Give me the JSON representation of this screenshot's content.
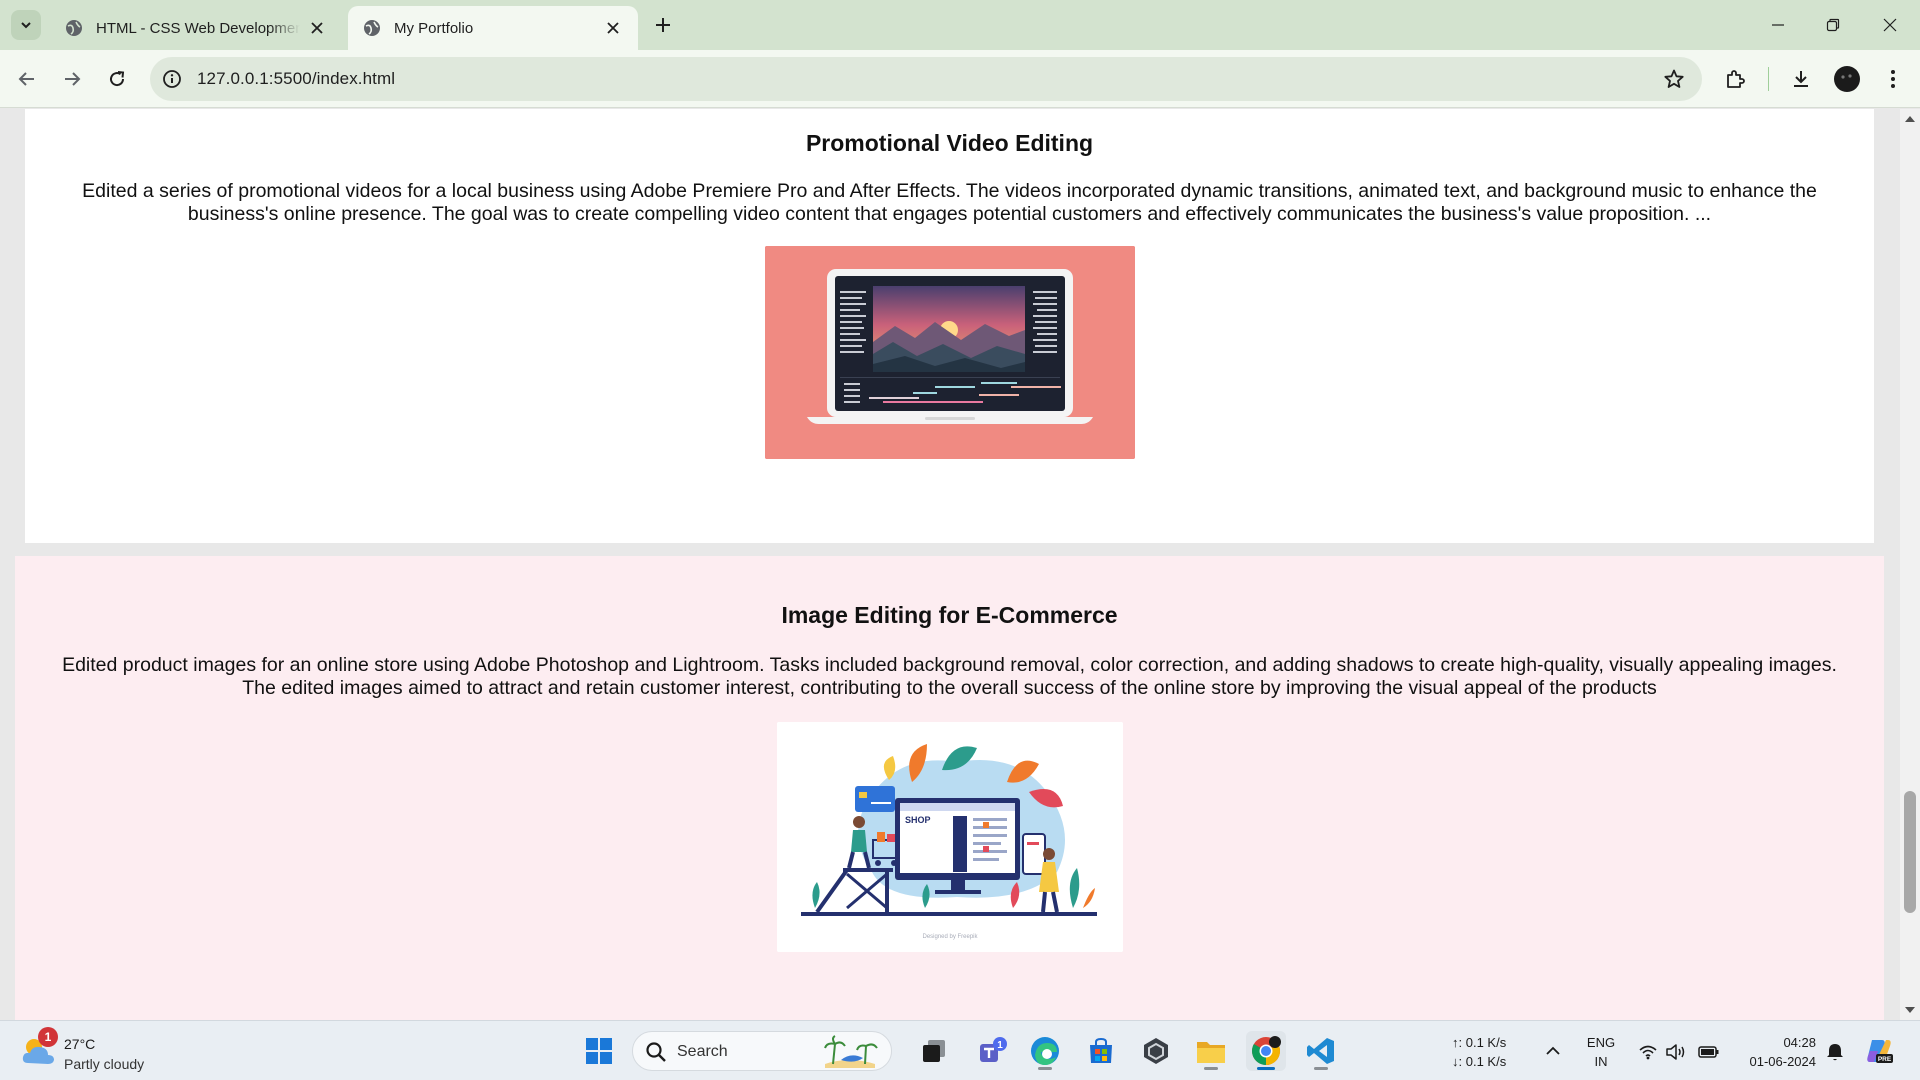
{
  "browser": {
    "tabs": [
      {
        "title": "HTML - CSS Web Development",
        "active": false
      },
      {
        "title": "My Portfolio",
        "active": true
      }
    ],
    "url": "127.0.0.1:5500/index.html"
  },
  "page": {
    "projects": [
      {
        "title": "Promotional Video Editing",
        "description": "Edited a series of promotional videos for a local business using Adobe Premiere Pro and After Effects. The videos incorporated dynamic transitions, animated text, and background music to enhance the business's online presence. The goal was to create compelling video content that engages potential customers and effectively communicates the business's value proposition. ...",
        "image_subject": "laptop-video-editor-illustration"
      },
      {
        "title": "Image Editing for E-Commerce",
        "description": "Edited product images for an online store using Adobe Photoshop and Lightroom. Tasks included background removal, color correction, and adding shadows to create high-quality, visually appealing images. The edited images aimed to attract and retain customer interest, contributing to the overall success of the online store by improving the visual appeal of the products",
        "image_subject": "online-shop-illustration",
        "image_shop_text": "SHOP",
        "image_credit": "Designed by Freepik"
      }
    ]
  },
  "taskbar": {
    "weather": {
      "temp": "27°C",
      "desc": "Partly cloudy",
      "badge": "1"
    },
    "search_placeholder": "Search",
    "teams_badge": "1",
    "net": {
      "up": "↑: 0.1 K/s",
      "down": "↓: 0.1 K/s"
    },
    "lang": {
      "line1": "ENG",
      "line2": "IN"
    },
    "clock": {
      "time": "04:28",
      "date": "01-06-2024"
    },
    "copilot_badge": "PRE"
  },
  "colors": {
    "tabbar_bg": "#d3e3cf",
    "toolbar_bg": "#f3f8f1",
    "card_one_bg": "#ffffff",
    "card_two_bg": "#fdedf1",
    "video_thumb_bg": "#f08a82",
    "taskbar_bg": "#e9eef3"
  }
}
